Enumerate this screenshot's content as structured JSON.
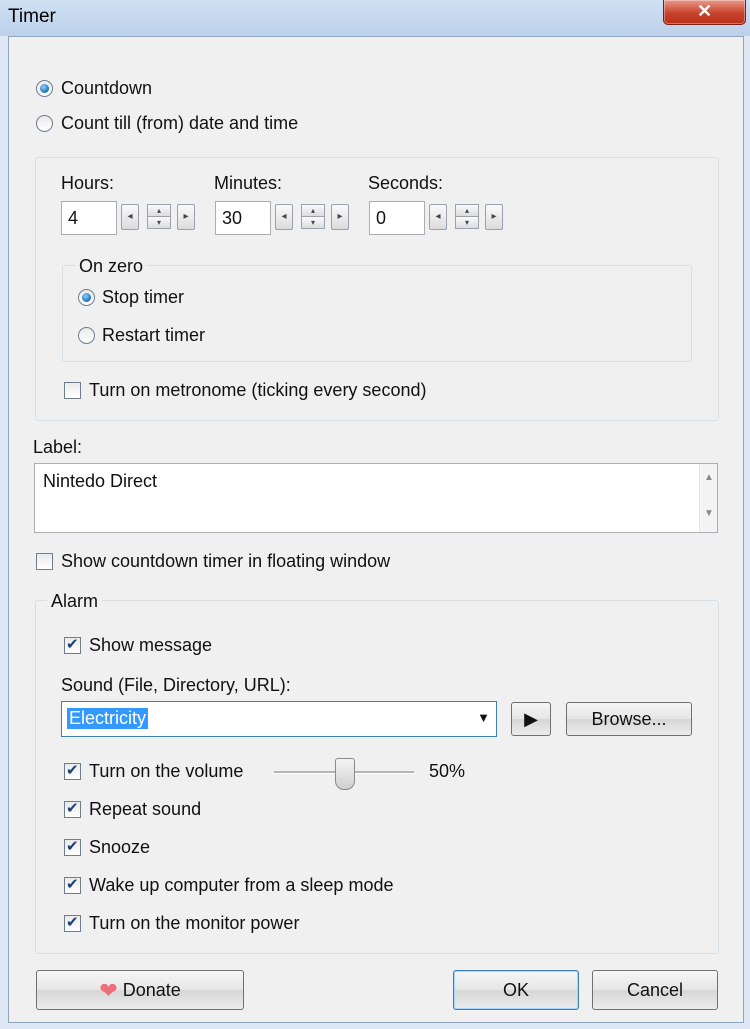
{
  "window": {
    "title": "Timer",
    "close_label": "✕"
  },
  "mode": {
    "countdown_label": "Countdown",
    "count_till_label": "Count till (from) date and time"
  },
  "time": {
    "hours_label": "Hours:",
    "hours_value": "4",
    "minutes_label": "Minutes:",
    "minutes_value": "30",
    "seconds_label": "Seconds:",
    "seconds_value": "0"
  },
  "on_zero": {
    "legend": "On zero",
    "stop_label": "Stop timer",
    "restart_label": "Restart timer"
  },
  "metronome_label": "Turn on metronome (ticking every second)",
  "label_section": {
    "label": "Label:",
    "value": "Nintedo Direct"
  },
  "floating_label": "Show countdown timer in floating window",
  "alarm": {
    "legend": "Alarm",
    "show_message_label": "Show message",
    "sound_label": "Sound (File, Directory, URL):",
    "sound_value": "Electricity",
    "browse_label": "Browse...",
    "volume_label": "Turn on the volume",
    "volume_value": "50%",
    "volume_level": 0.5,
    "repeat_label": "Repeat sound",
    "snooze_label": "Snooze",
    "wake_label": "Wake up computer from a sleep mode",
    "monitor_label": "Turn on the monitor power"
  },
  "footer": {
    "donate_label": "Donate",
    "ok_label": "OK",
    "cancel_label": "Cancel"
  }
}
